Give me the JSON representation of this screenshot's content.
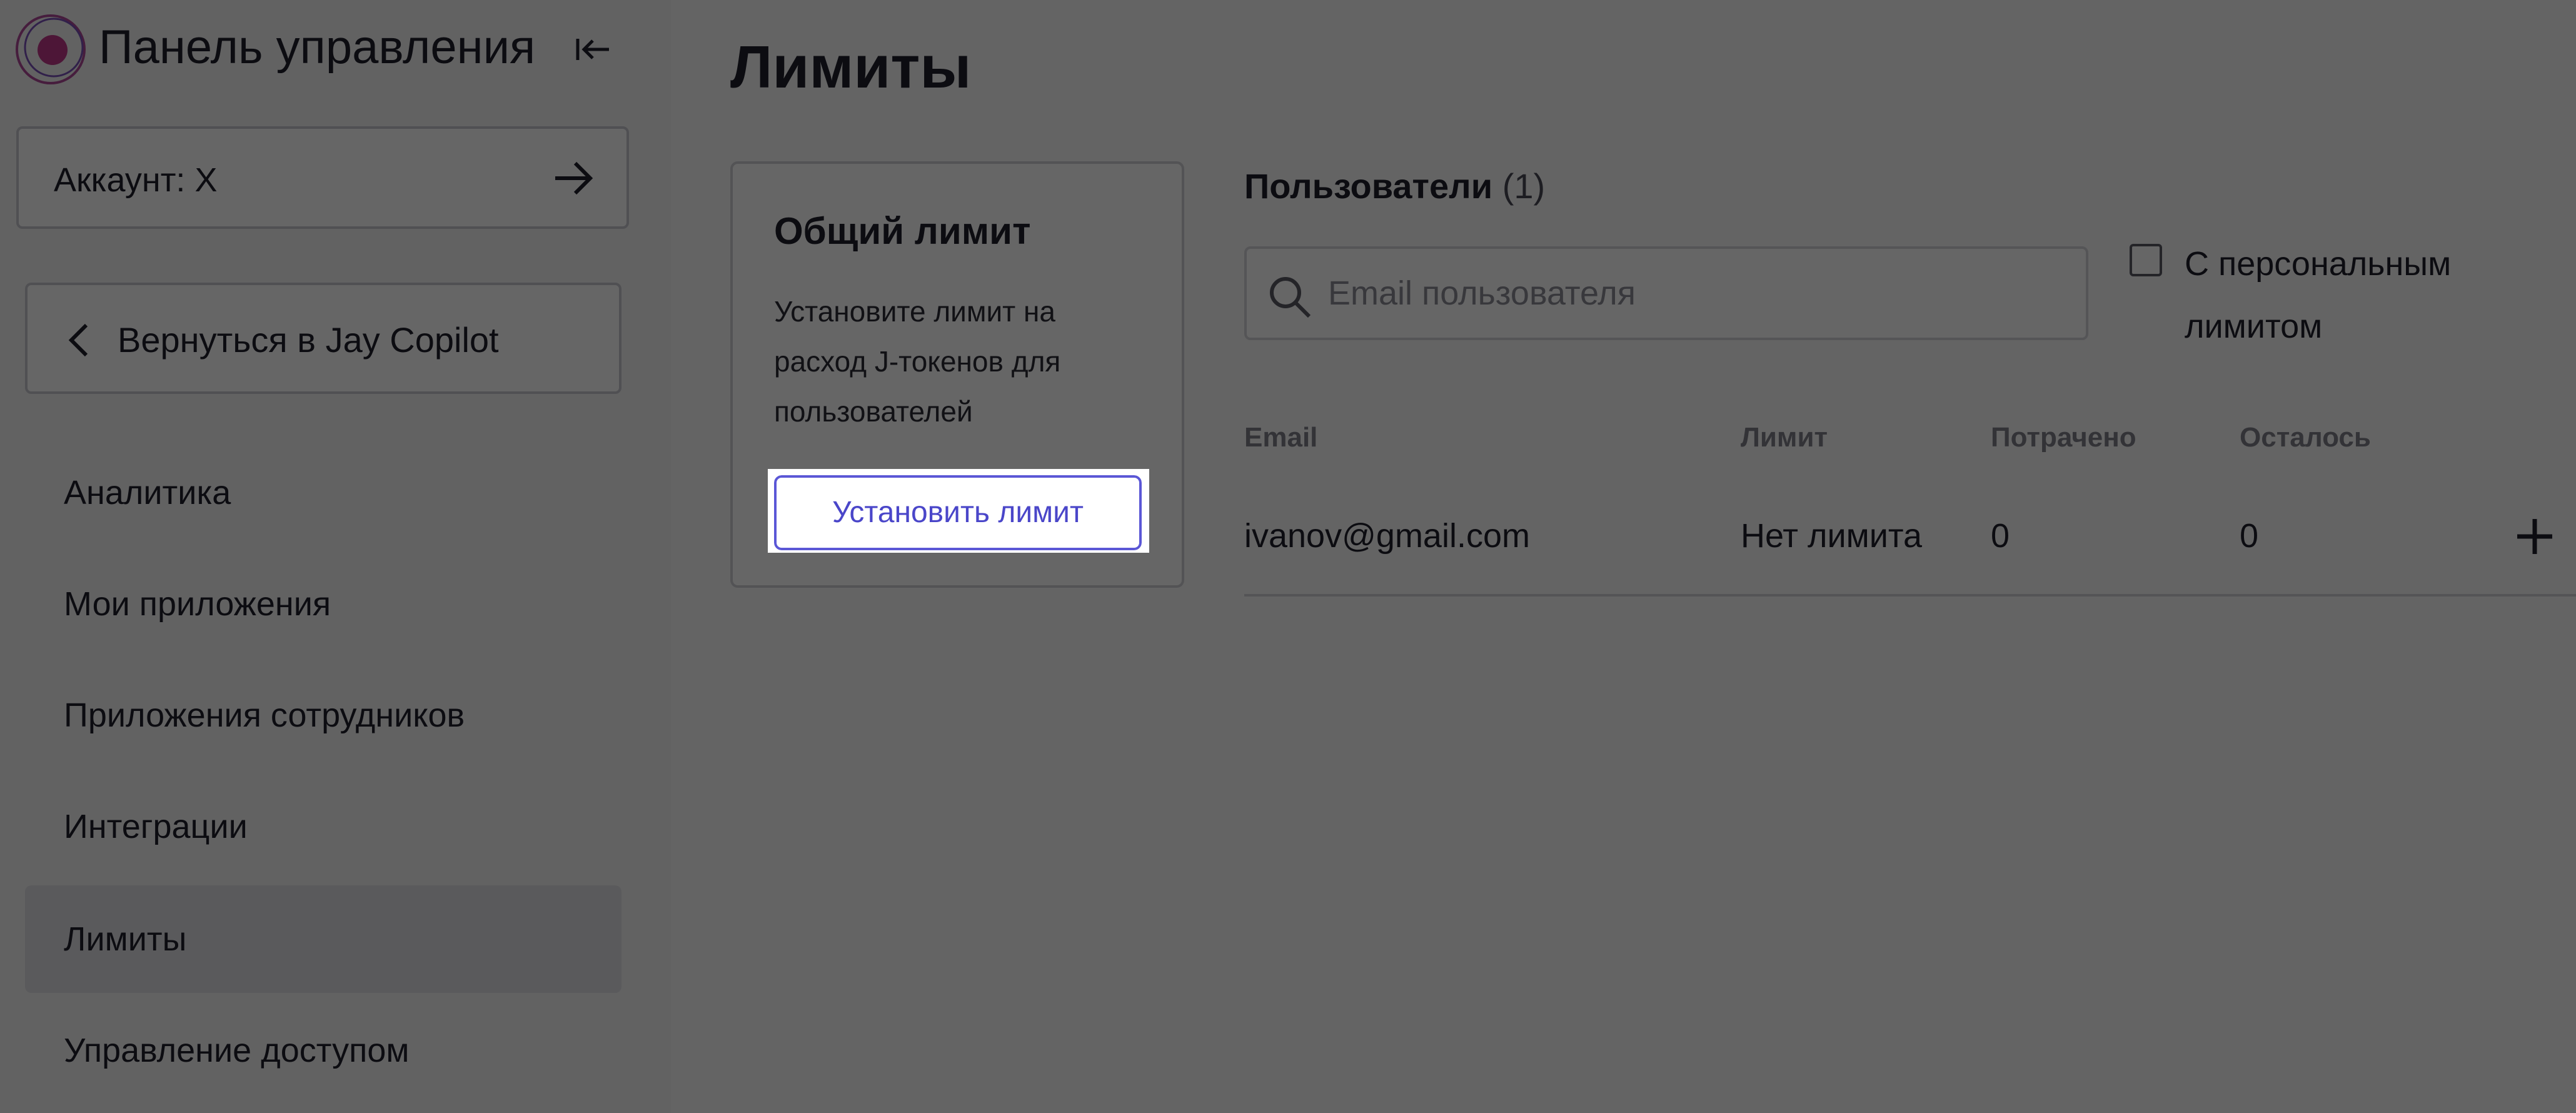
{
  "sidebar": {
    "app_title": "Панель управления",
    "account_label": "Аккаунт: X",
    "back_label": "Вернуться в Jay Copilot",
    "items": [
      {
        "label": "Аналитика"
      },
      {
        "label": "Мои приложения"
      },
      {
        "label": "Приложения сотрудников"
      },
      {
        "label": "Интеграции"
      },
      {
        "label": "Лимиты",
        "active": true
      },
      {
        "label": "Управление доступом"
      }
    ]
  },
  "main": {
    "title": "Лимиты",
    "limit_card": {
      "title": "Общий лимит",
      "description": "Установите лимит на расход J-токенов для пользователей",
      "button_label": "Установить лимит"
    },
    "users": {
      "heading": "Пользователи",
      "count": "(1)",
      "search_placeholder": "Email пользователя",
      "search_value": "",
      "personal_limit_label": "С персональным лимитом",
      "personal_limit_checked": false,
      "columns": [
        "Email",
        "Лимит",
        "Потрачено",
        "Осталось"
      ],
      "rows": [
        {
          "email": "ivanov@gmail.com",
          "limit": "Нет лимита",
          "spent": "0",
          "remaining": "0"
        }
      ]
    }
  },
  "icons": {
    "logo": "logo-icon",
    "collapse": "collapse-sidebar-icon",
    "account_arrow": "arrow-right-icon",
    "back": "chevron-left-icon",
    "search": "search-icon",
    "add": "plus-icon"
  },
  "colors": {
    "accent": "#5b57d6",
    "logo_fill": "#c0398a",
    "overlay": "rgba(0,0,0,0.6)"
  }
}
